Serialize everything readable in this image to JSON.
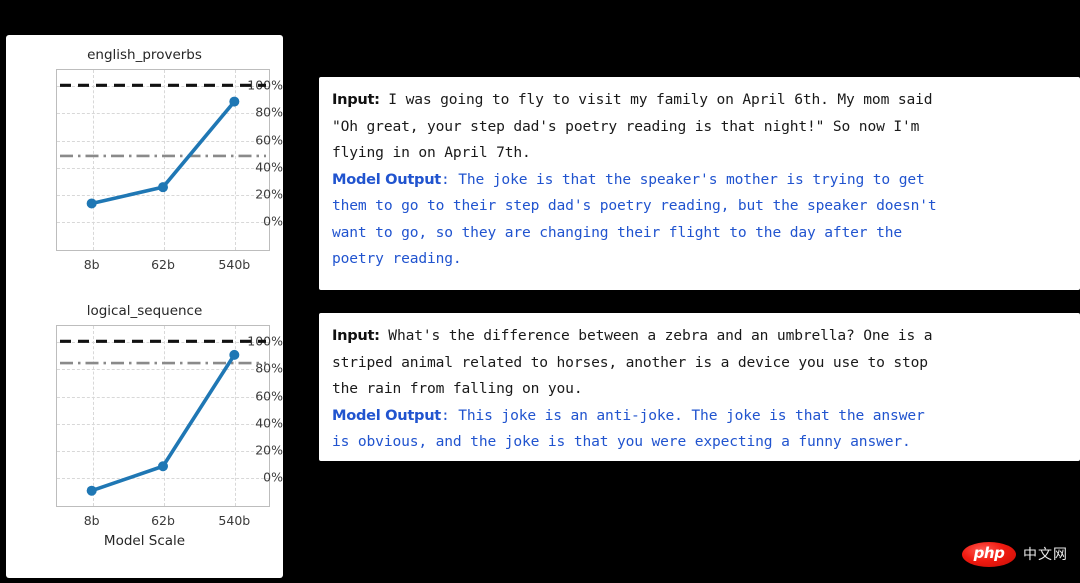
{
  "chart_data": [
    {
      "type": "line",
      "title": "english_proverbs",
      "xlabel": "",
      "ylabel": "",
      "categories": [
        "8b",
        "62b",
        "540b"
      ],
      "x": [
        0,
        1,
        2
      ],
      "values": [
        13,
        25,
        88
      ],
      "ylim": [
        -22,
        112
      ],
      "yticks": [
        0,
        20,
        40,
        60,
        80,
        100
      ],
      "ytick_labels": [
        "0%",
        "20%",
        "40%",
        "60%",
        "80%",
        "100%"
      ],
      "grid": true,
      "legend": "none",
      "annotations": [
        {
          "name": "max-score-line",
          "value": 100,
          "style": "dashed",
          "color": "#111111"
        },
        {
          "name": "human-baseline-line",
          "value": 48,
          "style": "dashdot",
          "color": "#8a8a8a"
        }
      ],
      "series_color": "#1f77b4"
    },
    {
      "type": "line",
      "title": "logical_sequence",
      "xlabel": "Model Scale",
      "ylabel": "",
      "categories": [
        "8b",
        "62b",
        "540b"
      ],
      "x": [
        0,
        1,
        2
      ],
      "values": [
        -10,
        8,
        90
      ],
      "ylim": [
        -22,
        112
      ],
      "yticks": [
        0,
        20,
        40,
        60,
        80,
        100
      ],
      "ytick_labels": [
        "0%",
        "20%",
        "40%",
        "60%",
        "80%",
        "100%"
      ],
      "grid": true,
      "legend": "none",
      "annotations": [
        {
          "name": "max-score-line",
          "value": 100,
          "style": "dashed",
          "color": "#111111"
        },
        {
          "name": "human-baseline-line",
          "value": 84,
          "style": "dashdot",
          "color": "#8a8a8a"
        }
      ],
      "series_color": "#1f77b4"
    }
  ],
  "examples": [
    {
      "input_label": "Input:",
      "output_label": "Model Output",
      "output_label_colon": ":",
      "input_lines": [
        " I was going to fly to visit my family on April 6th. My mom said",
        "\"Oh great, your step dad's poetry reading is that night!\" So now I'm",
        "flying in on April 7th."
      ],
      "output_lines": [
        " The joke is that the speaker's mother is trying to get",
        "them to go to their step dad's poetry reading, but the speaker doesn't",
        "want to go, so they are changing their flight to the day after the",
        "poetry reading."
      ]
    },
    {
      "input_label": "Input:",
      "output_label": "Model Output",
      "output_label_colon": ":",
      "input_lines": [
        " What's the difference between a zebra and an umbrella? One is a",
        "striped animal related to horses, another is a device you use to stop",
        "the rain from falling on you."
      ],
      "output_lines": [
        " This joke is an anti-joke. The joke is that the answer",
        "is obvious, and the joke is that you were expecting a funny answer."
      ]
    }
  ],
  "watermark": {
    "badge_text": "php",
    "site_text": "中文网"
  },
  "colors": {
    "series": "#1f77b4",
    "output_text": "#2154cf",
    "input_text": "#1a1a1a",
    "max_line": "#111111",
    "baseline_line": "#8a8a8a",
    "panel_bg": "#ffffff",
    "page_bg": "#000000"
  }
}
